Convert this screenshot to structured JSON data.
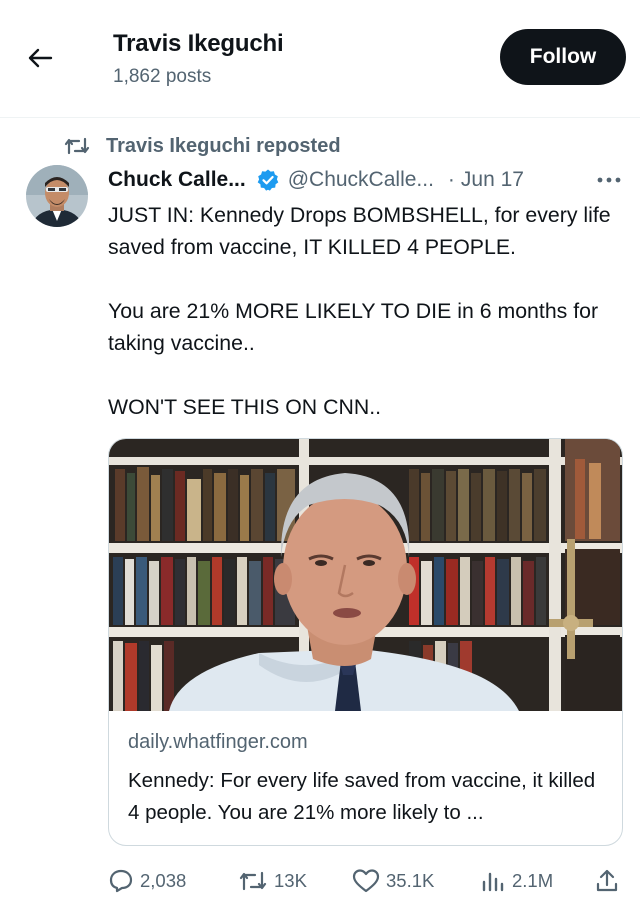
{
  "header": {
    "title": "Travis Ikeguchi",
    "posts_count": "1,862 posts",
    "follow_label": "Follow"
  },
  "repost": {
    "text": "Travis Ikeguchi reposted"
  },
  "post": {
    "author_name": "Chuck Calle...",
    "author_handle": "@ChuckCalle...",
    "separator": "·",
    "date": "Jun 17",
    "text": [
      "JUST IN: Kennedy Drops BOMBSHELL, for every life saved from vaccine, IT KILLED 4 PEOPLE.",
      "You are 21% MORE LIKELY TO DIE in 6 months for taking vaccine..",
      "WON'T SEE THIS ON CNN.."
    ],
    "card": {
      "domain": "daily.whatfinger.com",
      "title": "Kennedy: For every life saved from vaccine, it killed 4 people. You are 21% more likely to ..."
    }
  },
  "actions": {
    "replies": "2,038",
    "reposts": "13K",
    "likes": "35.1K",
    "views": "2.1M"
  },
  "icons": [
    "back-arrow-icon",
    "repost-icon",
    "verified-badge-icon",
    "more-icon",
    "reply-icon",
    "like-icon",
    "views-icon",
    "share-icon"
  ],
  "colors": {
    "text": "#0f1419",
    "secondary": "#536471",
    "verified": "#1d9bf0",
    "follow_bg": "#0f1419",
    "border": "#cfd9de"
  }
}
